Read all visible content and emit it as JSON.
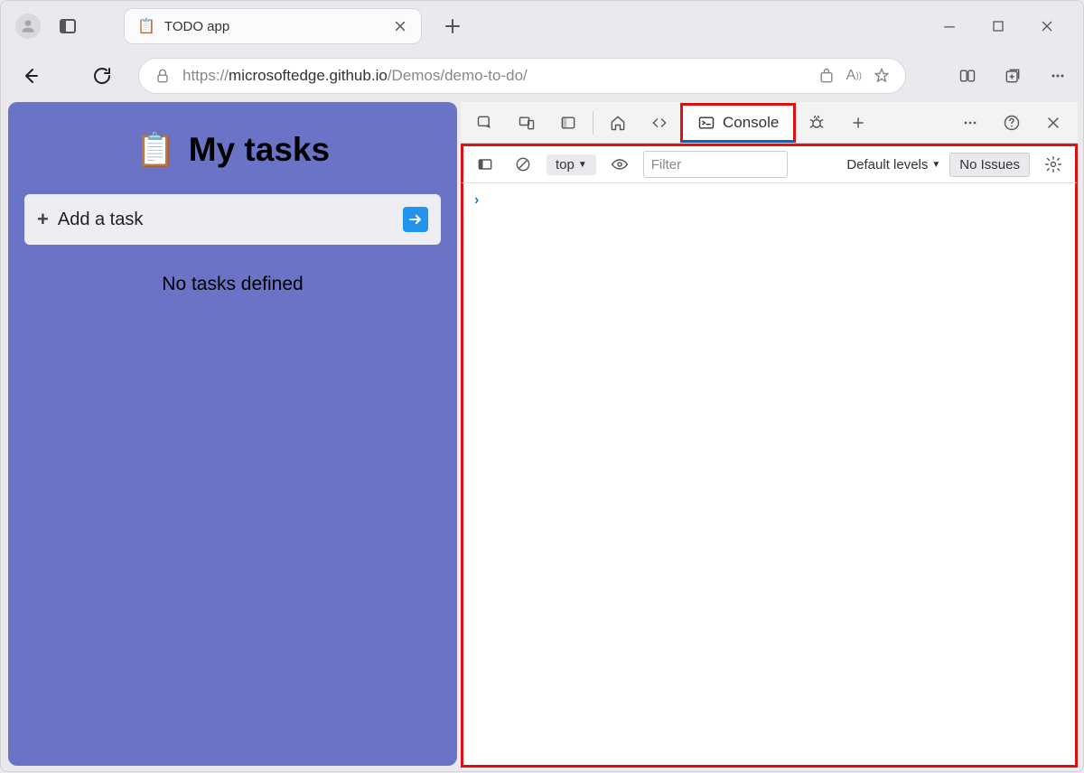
{
  "browser": {
    "tab_title": "TODO app",
    "url_faded_prefix": "https://",
    "url_domain": "microsoftedge.github.io",
    "url_path": "/Demos/demo-to-do/"
  },
  "page": {
    "heading": "My tasks",
    "add_task_label": "Add a task",
    "no_tasks_label": "No tasks defined"
  },
  "devtools": {
    "console_tab_label": "Console",
    "context_label": "top",
    "filter_placeholder": "Filter",
    "levels_label": "Default levels",
    "issues_label": "No Issues",
    "prompt": "›"
  }
}
